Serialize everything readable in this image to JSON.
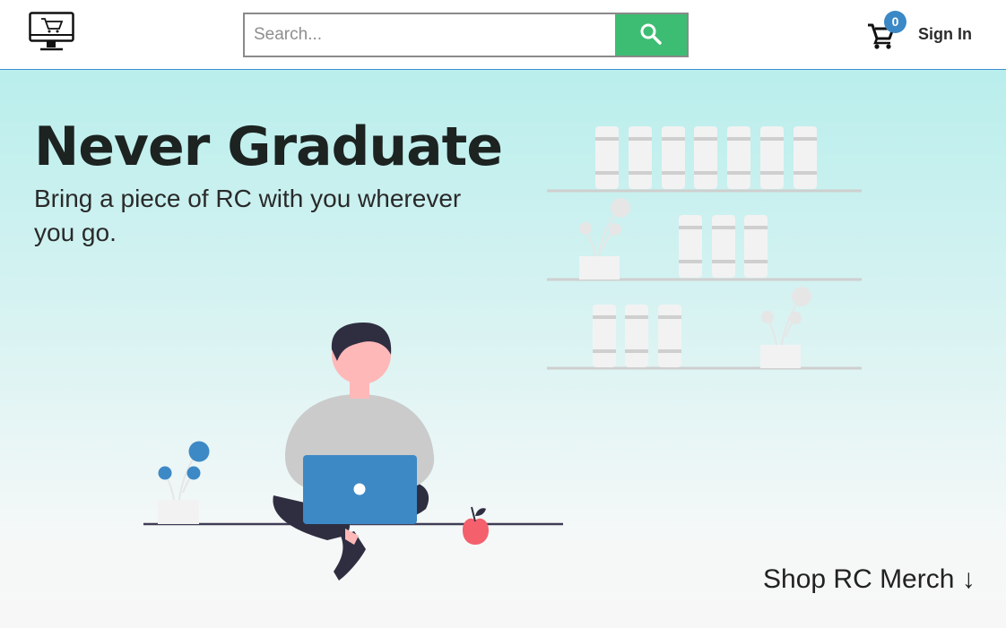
{
  "header": {
    "logo_icon": "shopping-monitor-icon",
    "search": {
      "placeholder": "Search...",
      "value": "",
      "button_icon": "search-icon"
    },
    "cart": {
      "icon": "shopping-cart-icon",
      "count": "0"
    },
    "sign_in_label": "Sign In"
  },
  "hero": {
    "title": "Never Graduate",
    "subtitle": "Bring a piece of RC with you wherever you go.",
    "cta_label": "Shop RC Merch ↓"
  },
  "colors": {
    "search_button": "#3dbd73",
    "badge": "#3a88c6",
    "hero_top": "#b9eeec",
    "hero_bottom": "#f7f7f7",
    "laptop": "#3d89c6",
    "apple": "#f4606b"
  }
}
